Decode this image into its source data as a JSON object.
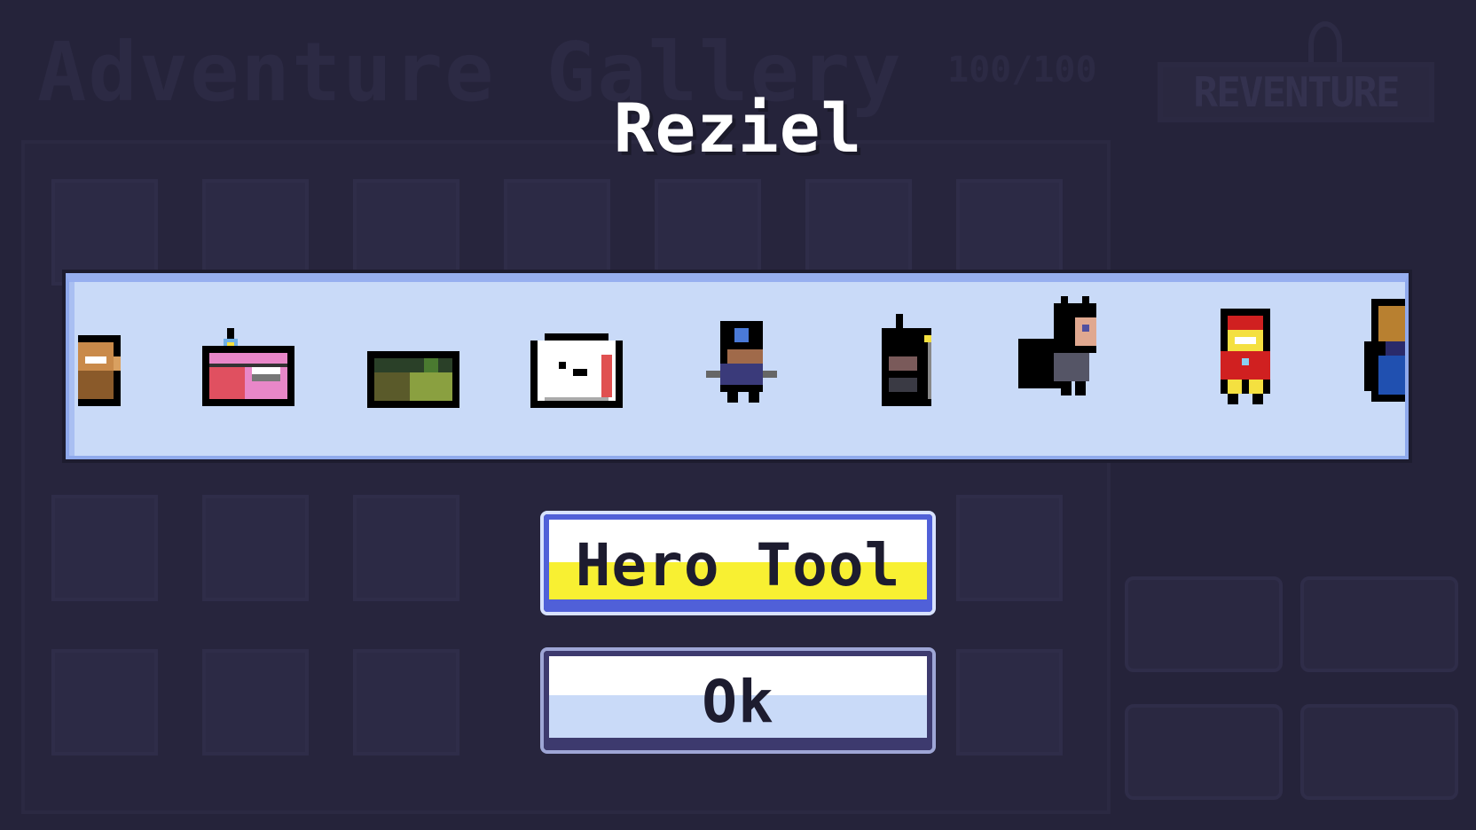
{
  "background": {
    "title": "Adventure Gallery",
    "counter": "100/100",
    "logo": "REVENTURE"
  },
  "popup": {
    "hero_name": "Reziel",
    "sprites": [
      "bearded-hero-sprite-icon",
      "pink-chest-sprite-icon",
      "green-box-sprite-icon",
      "ghost-block-sprite-icon",
      "ninja-hero-sprite-icon",
      "dark-knight-sprite-icon",
      "bat-caped-hero-sprite-icon",
      "red-gold-armor-hero-sprite-icon",
      "wizard-hero-sprite-icon"
    ],
    "hero_tool_button": "Hero Tool",
    "ok_button": "Ok"
  },
  "colors": {
    "background": "#25233a",
    "carousel": "#c9daf8",
    "hero_tool_fill": "#f8f032",
    "hero_tool_border": "#5060d8",
    "ok_border": "#3d3a6e"
  }
}
